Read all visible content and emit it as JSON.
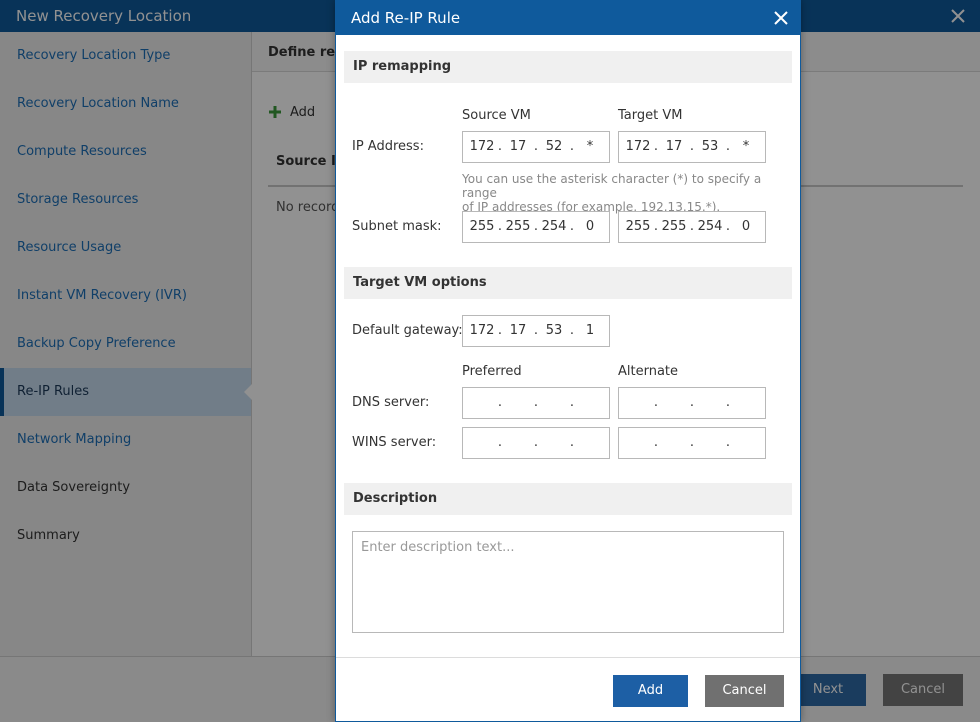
{
  "wizard": {
    "title": "New Recovery Location",
    "steps": [
      "Recovery Location Type",
      "Recovery Location Name",
      "Compute Resources",
      "Storage Resources",
      "Resource Usage",
      "Instant VM Recovery (IVR)",
      "Backup Copy Preference",
      "Re-IP Rules",
      "Network Mapping",
      "Data Sovereignty",
      "Summary"
    ],
    "content_heading": "Define re-I",
    "add_label": "Add",
    "column_header": "Source IP",
    "no_records": "No record",
    "next_label": "Next",
    "cancel_label": "Cancel"
  },
  "dialog": {
    "title": "Add Re-IP Rule",
    "ip_remapping": {
      "section_title": "IP remapping",
      "source_header": "Source VM",
      "target_header": "Target VM",
      "ip_address_label": "IP Address:",
      "source_ip": [
        "172",
        "17",
        "52",
        "*"
      ],
      "target_ip": [
        "172",
        "17",
        "53",
        "*"
      ],
      "hint_line1": "You can use the asterisk character (*) to specify a range",
      "hint_line2": "of IP addresses (for example, 192.13.15.*).",
      "subnet_label": "Subnet mask:",
      "source_subnet": [
        "255",
        "255",
        "254",
        "0"
      ],
      "target_subnet": [
        "255",
        "255",
        "254",
        "0"
      ]
    },
    "target_options": {
      "section_title": "Target VM options",
      "gateway_label": "Default gateway:",
      "gateway": [
        "172",
        "17",
        "53",
        "1"
      ],
      "preferred_header": "Preferred",
      "alternate_header": "Alternate",
      "dns_label": "DNS server:",
      "wins_label": "WINS server:"
    },
    "description": {
      "section_title": "Description",
      "placeholder": "Enter description text..."
    },
    "add_label": "Add",
    "cancel_label": "Cancel"
  },
  "colors": {
    "titlebar": "#0f5a9c",
    "link": "#1d6fb8",
    "active_step": "#c7dcef",
    "primary_button": "#1d5fa5",
    "secondary_button": "#707070",
    "add_plus": "#3a9a3a"
  }
}
